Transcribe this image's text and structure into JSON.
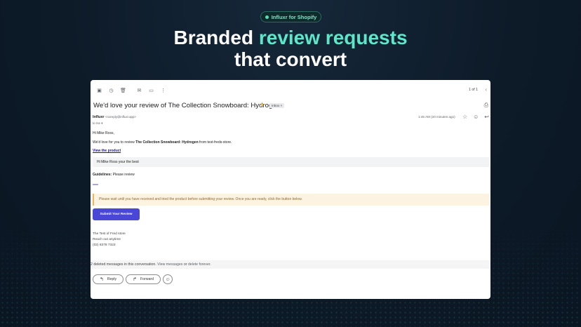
{
  "badge": {
    "label": "Influxr for Shopify"
  },
  "headline": {
    "part1": "Branded ",
    "accent": "review requests",
    "line2": "that convert"
  },
  "email": {
    "toolbar_icons": [
      "archive-icon",
      "snooze-icon",
      "delete-icon",
      "mark-unread-icon",
      "move-to-icon",
      "more-icon"
    ],
    "pager": "1 of 1",
    "subject": "We'd love your review of The Collection Snowboard: Hydrogen",
    "label_chip": "Inbox ×",
    "sender_name": "Influxr",
    "sender_addr": "<noreply@influxr.app>",
    "to_line": "to me ▾",
    "time": "1:45 AM (20 minutes ago)",
    "greeting": "Hi Mike Ross,",
    "body_pre": "We'd love for you to review ",
    "body_product": "The Collection Snowboard: Hydrogen",
    "body_post": " from test-freds-store.",
    "view_product": "View the product",
    "quote": "Hi Mike Ross your the best",
    "guidelines_label": "Guidelines:",
    "guidelines_text": " Please review",
    "warning": "Please wait until you have received and tried the product before submitting your review. Once you are ready, click the button below.",
    "submit_label": "Submit Your Review",
    "sig_line1": "The Test of Fred store",
    "sig_line2": "Reach out anytime",
    "sig_line3": "(02) 8378 7323",
    "deleted_pre": "2 deleted messages in this conversation. ",
    "deleted_view": "View messages",
    "deleted_or": " or ",
    "deleted_delete": "delete forever",
    "deleted_end": ".",
    "reply_label": "Reply",
    "forward_label": "Forward"
  },
  "colors": {
    "accent": "#5ee6c9",
    "button": "#4a46d6",
    "warning_bg": "#fdf3e2"
  }
}
